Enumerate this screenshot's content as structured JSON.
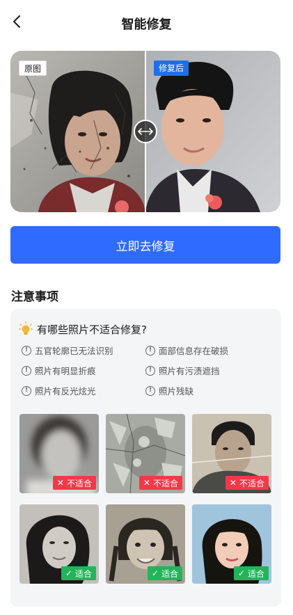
{
  "header": {
    "title": "智能修复",
    "back_icon": "chevron-left-icon"
  },
  "compare": {
    "before_label": "原图",
    "after_label": "修复后",
    "handle_icon": "left-right-arrow-icon"
  },
  "cta": {
    "label": "立即去修复",
    "color": "#2f6bff"
  },
  "notes": {
    "section_title": "注意事项",
    "question": "有哪些照片不适合修复?",
    "question_icon": "lightbulb-icon",
    "reasons": [
      "五官轮廓已无法识别",
      "面部信息存在破损",
      "照片有明显折痕",
      "照片有污渍遮挡",
      "照片有反光炫光",
      "照片残缺"
    ],
    "examples": [
      {
        "label": "不适合",
        "status": "bad"
      },
      {
        "label": "不适合",
        "status": "bad"
      },
      {
        "label": "不适合",
        "status": "bad"
      },
      {
        "label": "适合",
        "status": "good"
      },
      {
        "label": "适合",
        "status": "good"
      },
      {
        "label": "适合",
        "status": "good"
      }
    ]
  }
}
